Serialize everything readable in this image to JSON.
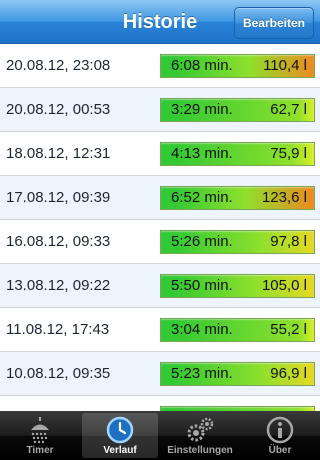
{
  "header": {
    "title": "Historie",
    "edit_label": "Bearbeiten"
  },
  "history": [
    {
      "date": "20.08.12, 23:08",
      "duration": "6:08 min.",
      "volume": "110,4 l",
      "fill": 0.95
    },
    {
      "date": "20.08.12, 00:53",
      "duration": "3:29 min.",
      "volume": "62,7 l",
      "fill": 0.54
    },
    {
      "date": "18.08.12, 12:31",
      "duration": "4:13 min.",
      "volume": "75,9 l",
      "fill": 0.65
    },
    {
      "date": "17.08.12, 09:39",
      "duration": "6:52 min.",
      "volume": "123,6 l",
      "fill": 1.0
    },
    {
      "date": "16.08.12, 09:33",
      "duration": "5:26 min.",
      "volume": "97,8 l",
      "fill": 0.84
    },
    {
      "date": "13.08.12, 09:22",
      "duration": "5:50 min.",
      "volume": "105,0 l",
      "fill": 0.9
    },
    {
      "date": "11.08.12, 17:43",
      "duration": "3:04 min.",
      "volume": "55,2 l",
      "fill": 0.48
    },
    {
      "date": "10.08.12, 09:35",
      "duration": "5:23 min.",
      "volume": "96,9 l",
      "fill": 0.83
    },
    {
      "date": "",
      "duration": "",
      "volume": "",
      "fill": 0.5
    }
  ],
  "colors": {
    "low": "#31c934",
    "mid": "#d7ef27",
    "high": "#ec8a20"
  },
  "tabs": [
    {
      "label": "Timer",
      "icon": "shower-icon",
      "active": false
    },
    {
      "label": "Verlauf",
      "icon": "clock-icon",
      "active": true
    },
    {
      "label": "Einstellungen",
      "icon": "gears-icon",
      "active": false
    },
    {
      "label": "Über",
      "icon": "info-icon",
      "active": false
    }
  ]
}
